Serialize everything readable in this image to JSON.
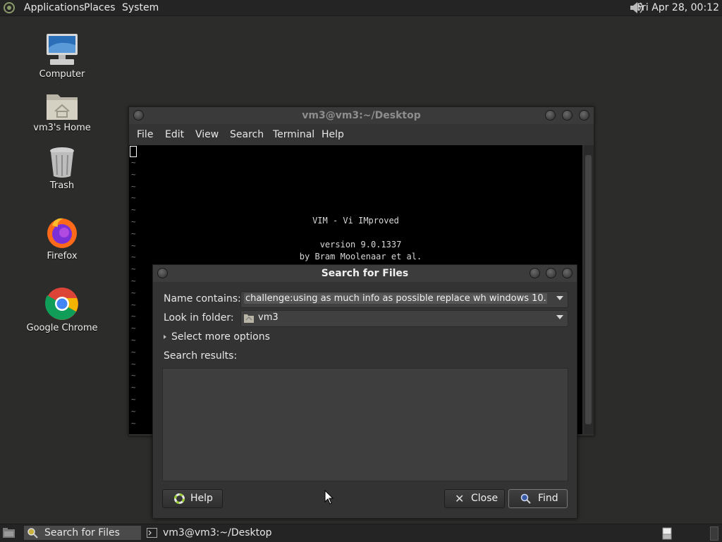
{
  "topbar": {
    "menus": [
      "Applications",
      "Places",
      "System"
    ],
    "clock": "Fri Apr 28, 00:12"
  },
  "desktop_icons": [
    {
      "label": "Computer",
      "icon": "computer-icon"
    },
    {
      "label": "vm3's Home",
      "icon": "home-folder-icon"
    },
    {
      "label": "Trash",
      "icon": "trash-icon"
    },
    {
      "label": "Firefox",
      "icon": "firefox-icon"
    },
    {
      "label": "Google Chrome",
      "icon": "chrome-icon"
    }
  ],
  "terminal": {
    "title": "vm3@vm3:~/Desktop",
    "menu": [
      "File",
      "Edit",
      "View",
      "Search",
      "Terminal",
      "Help"
    ],
    "vim_lines": [
      "VIM - Vi IMproved",
      "version 9.0.1337",
      "by Bram Moolenaar et al."
    ],
    "tilde": "~"
  },
  "search_dialog": {
    "title": "Search for Files",
    "name_label": "Name contains:",
    "name_value": "challenge:using as much info as possible replace wh windows 10.",
    "folder_label": "Look in folder:",
    "folder_value": "vm3",
    "more_options": "Select more options",
    "results_label": "Search results:",
    "help_label": "Help",
    "close_label": "Close",
    "find_label": "Find"
  },
  "taskbar": {
    "items": [
      {
        "label": "Search for Files",
        "active": true
      },
      {
        "label": "vm3@vm3:~/Desktop",
        "active": false
      }
    ]
  }
}
